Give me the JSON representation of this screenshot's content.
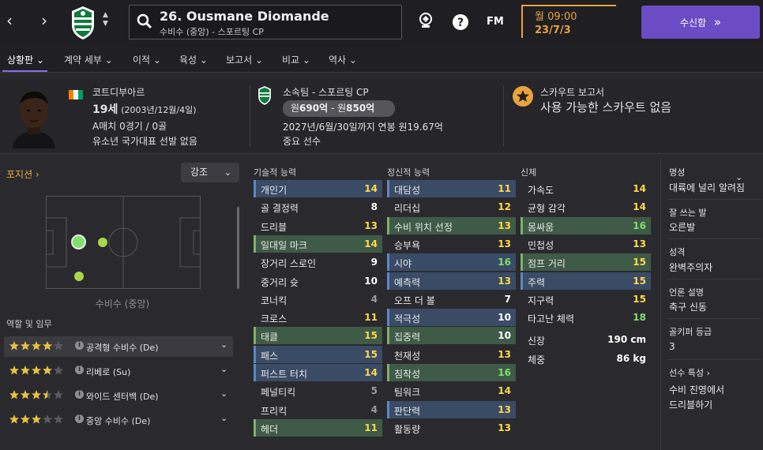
{
  "header": {
    "player_title": "26. Ousmane Diomande",
    "player_subtitle": "수비수 (중앙) - 스포르팅 CP",
    "fm_label": "FM",
    "date_day": "월 09:00",
    "date_full": "23/7/3",
    "inbox_label": "수신함",
    "inbox_arrow": "»"
  },
  "tabs": [
    {
      "label": "상황판"
    },
    {
      "label": "계약 세부"
    },
    {
      "label": "이적"
    },
    {
      "label": "육성"
    },
    {
      "label": "보고서"
    },
    {
      "label": "비교"
    },
    {
      "label": "역사"
    }
  ],
  "info": {
    "nationality": "코트디부아르",
    "age": "19세",
    "dob": "(2003년/12월/4일)",
    "caps": "A매치 0경기 / 0골",
    "youth": "유소년 국가대표 선발 없음",
    "club": "소속팀 - 스포르팅 CP",
    "value_pre": "원",
    "value_low": "690억",
    "value_mid": " - 원",
    "value_high": "850억",
    "contract": "2027년/6월/30일까지 연봉 원19.67억",
    "squad_status": "중요 선수",
    "scout_title": "스카우트 보고서",
    "scout_text": "사용 가능한 스카우트 없음"
  },
  "left": {
    "position_link": "포지션 ›",
    "emphasis_label": "강조",
    "position_caption": "수비수 (중앙)",
    "roles_heading": "역할 및 임무",
    "roles": [
      {
        "label": "공격형 수비수 (De)",
        "stars": 4
      },
      {
        "label": "리베로 (Su)",
        "stars": 4
      },
      {
        "label": "와이드 센터백 (De)",
        "stars": 3.5
      },
      {
        "label": "중앙 수비수 (De)",
        "stars": 3
      }
    ]
  },
  "attributes": {
    "technical_heading": "기술적 능력",
    "mental_heading": "정신적 능력",
    "physical_heading": "신체",
    "technical": [
      {
        "name": "개인기",
        "value": 14,
        "hl": "blue"
      },
      {
        "name": "골 결정력",
        "value": 8,
        "hl": ""
      },
      {
        "name": "드리블",
        "value": 13,
        "hl": ""
      },
      {
        "name": "일대일 마크",
        "value": 14,
        "hl": "green"
      },
      {
        "name": "장거리 스로인",
        "value": 9,
        "hl": ""
      },
      {
        "name": "중거리 슛",
        "value": 10,
        "hl": ""
      },
      {
        "name": "코너킥",
        "value": 4,
        "hl": ""
      },
      {
        "name": "크로스",
        "value": 11,
        "hl": ""
      },
      {
        "name": "태클",
        "value": 15,
        "hl": "green"
      },
      {
        "name": "패스",
        "value": 15,
        "hl": "blue"
      },
      {
        "name": "퍼스트 터치",
        "value": 14,
        "hl": "blue"
      },
      {
        "name": "페널티킥",
        "value": 5,
        "hl": ""
      },
      {
        "name": "프리킥",
        "value": 4,
        "hl": ""
      },
      {
        "name": "헤더",
        "value": 11,
        "hl": "green"
      }
    ],
    "mental": [
      {
        "name": "대담성",
        "value": 11,
        "hl": "blue"
      },
      {
        "name": "리더십",
        "value": 12,
        "hl": ""
      },
      {
        "name": "수비 위치 선정",
        "value": 13,
        "hl": "green"
      },
      {
        "name": "승부욕",
        "value": 13,
        "hl": ""
      },
      {
        "name": "시야",
        "value": 16,
        "hl": "blue"
      },
      {
        "name": "예측력",
        "value": 13,
        "hl": "blue"
      },
      {
        "name": "오프 더 볼",
        "value": 7,
        "hl": ""
      },
      {
        "name": "적극성",
        "value": 10,
        "hl": "blue"
      },
      {
        "name": "집중력",
        "value": 10,
        "hl": "green"
      },
      {
        "name": "천재성",
        "value": 13,
        "hl": ""
      },
      {
        "name": "침착성",
        "value": 16,
        "hl": "green"
      },
      {
        "name": "팀워크",
        "value": 14,
        "hl": ""
      },
      {
        "name": "판단력",
        "value": 13,
        "hl": "blue"
      },
      {
        "name": "활동량",
        "value": 13,
        "hl": ""
      }
    ],
    "physical": [
      {
        "name": "가속도",
        "value": "14",
        "hl": ""
      },
      {
        "name": "균형 감각",
        "value": "14",
        "hl": ""
      },
      {
        "name": "몸싸움",
        "value": "16",
        "hl": "green"
      },
      {
        "name": "민첩성",
        "value": "13",
        "hl": ""
      },
      {
        "name": "점프 거리",
        "value": "15",
        "hl": "green"
      },
      {
        "name": "주력",
        "value": "15",
        "hl": "blue"
      },
      {
        "name": "지구력",
        "value": "15",
        "hl": ""
      },
      {
        "name": "타고난 체력",
        "value": "18",
        "hl": ""
      },
      {
        "name": "신장",
        "value": "190 cm",
        "hl": ""
      },
      {
        "name": "체중",
        "value": "86 kg",
        "hl": ""
      }
    ]
  },
  "right": {
    "fame_label": "명성",
    "fame_value": "대륙에 널리 알려짐",
    "foot_label": "잘 쓰는 발",
    "foot_value": "오른발",
    "personality_label": "성격",
    "personality_value": "완벽주의자",
    "media_label": "언론 설명",
    "media_value": "축구 신동",
    "gk_label": "골키퍼 등급",
    "gk_value": "3",
    "traits_label": "선수 특성 ›",
    "trait_line1": "수비 진영에서",
    "trait_line2": "드리블하기"
  },
  "colors": {
    "accent": "#8b6be5",
    "orange": "#e8a33d",
    "blue_hl": "#3a4b66",
    "green_hl": "#3f5a46",
    "val_white": "#ffffff",
    "val_grey": "#9a9aa0",
    "val_yellow": "#ffd84a",
    "val_green": "#7fe06a"
  }
}
